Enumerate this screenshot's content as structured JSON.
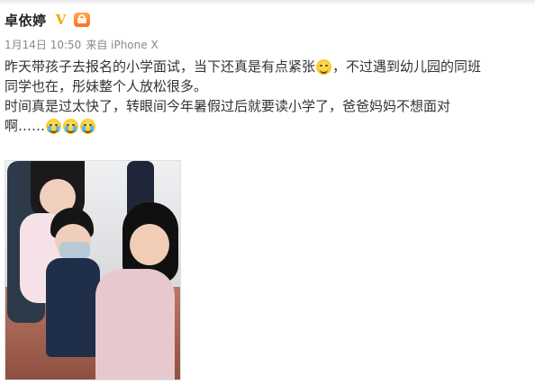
{
  "post": {
    "author": "卓依婷",
    "timestamp": "1月14日 10:50",
    "source": "来自 iPhone X",
    "lines": [
      {
        "text_a": "昨天带孩子去报名的小学面试，当下还真是有点紧张",
        "text_b": "，不过遇到幼儿园的同班"
      },
      {
        "text_a": "同学也在，彤妹整个人放松很多。"
      },
      {
        "text_a": "时间真是过太快了，转眼间今年暑假过后就要读小学了，爸爸妈妈不想面对"
      },
      {
        "text_a": "啊……"
      }
    ],
    "icons": {
      "verified": "verified-badge-icon",
      "level": "crown-level-icon",
      "emoji_laugh": "laugh-emoji-icon",
      "emoji_cry": "cry-emoji-icon"
    }
  },
  "verified_mark": "V"
}
